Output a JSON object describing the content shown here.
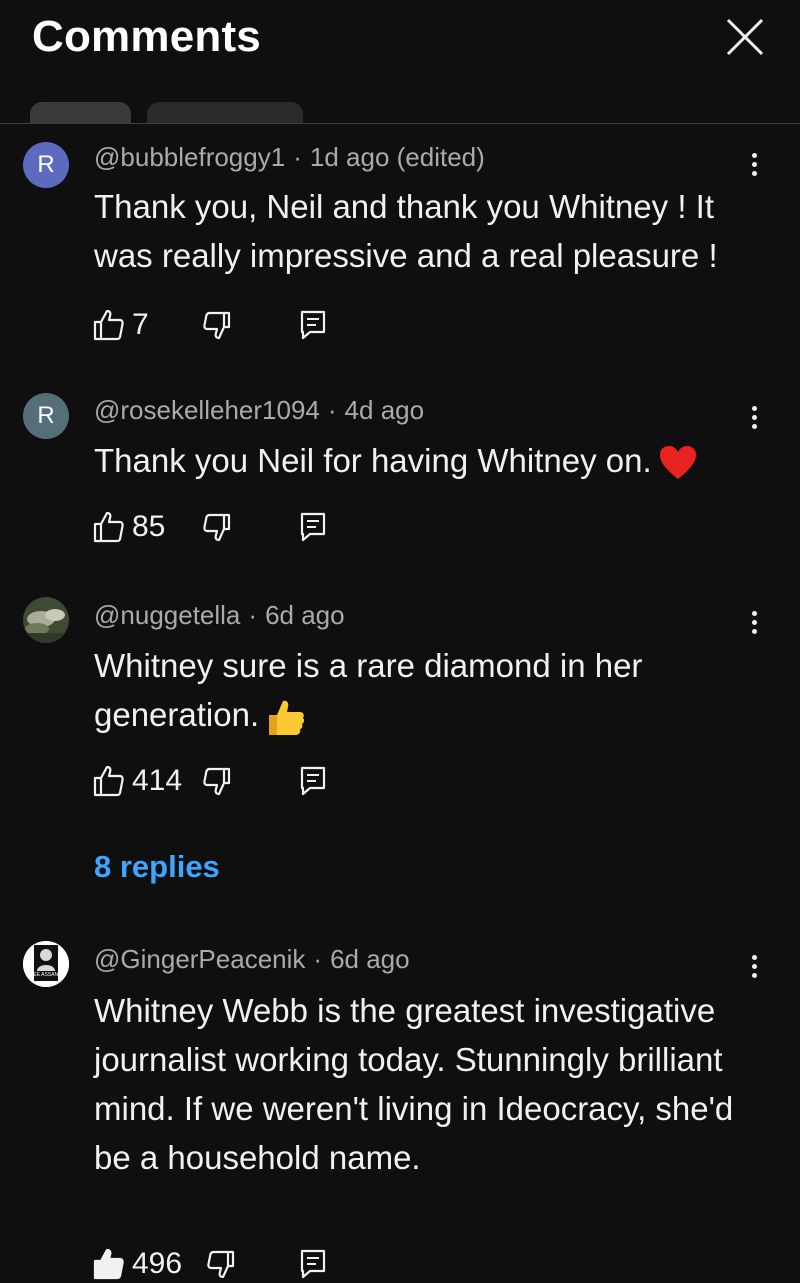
{
  "panel": {
    "title": "Comments"
  },
  "comments": [
    {
      "avatar_letter": "R",
      "avatar_color": "#5c6bc0",
      "author": "@bubblefroggy1",
      "time": "1d ago (edited)",
      "text": "Thank you, Neil and thank you Whitney ! It was really impressive and a real pleasure !",
      "likes": "7"
    },
    {
      "avatar_letter": "R",
      "avatar_color": "#546e7a",
      "author": "@rosekelleher1094",
      "time": "4d ago",
      "text": "Thank you Neil for having Whitney on.",
      "emoji": "heart-emoji",
      "likes": "85"
    },
    {
      "avatar_icon": "photo-avatar",
      "author": "@nuggetella",
      "time": "6d ago",
      "text": "Whitney sure is a rare diamond in her generation.",
      "emoji": "thumbs-up-emoji",
      "likes": "414",
      "replies_label": "8 replies"
    },
    {
      "avatar_icon": "photo-avatar",
      "avatar_text": "FREE ASSANGE",
      "author": "@GingerPeacenik",
      "time": "6d ago",
      "text": "Whitney Webb is the greatest investigative journalist working today. Stunningly brilliant mind. If we weren't living in Ideocracy, she'd be a household name.",
      "likes": "496"
    }
  ],
  "colors": {
    "background": "#0f0f0f",
    "link": "#3ea6ff",
    "secondary_text": "#aaaaaa"
  }
}
